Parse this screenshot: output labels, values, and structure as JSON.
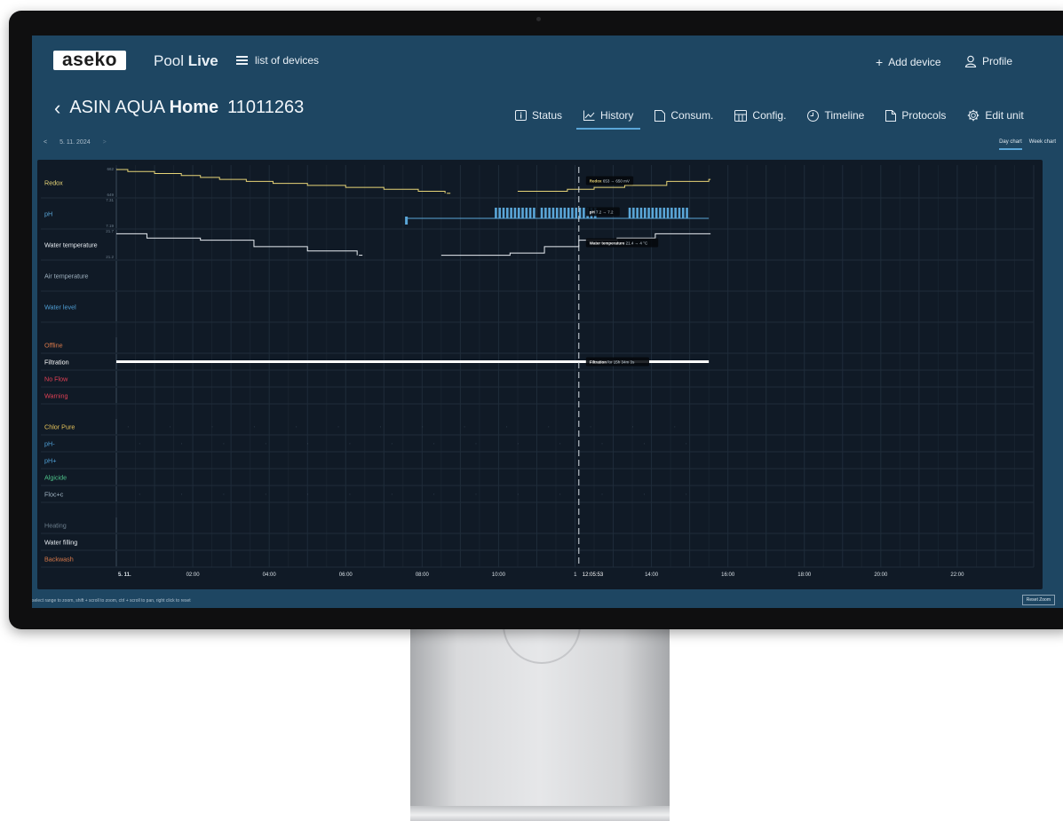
{
  "header": {
    "logo": "aseko",
    "brand_light": "Pool ",
    "brand_bold": "Live",
    "devices_link": "list of devices",
    "add_device": "Add device",
    "profile": "Profile"
  },
  "unit": {
    "name_light": "ASIN AQUA ",
    "name_bold": "Home",
    "serial": "11011263"
  },
  "tabs": [
    {
      "label": "Status",
      "icon": "info-icon"
    },
    {
      "label": "History",
      "icon": "chart-line-icon",
      "active": true
    },
    {
      "label": "Consum.",
      "icon": "document-icon"
    },
    {
      "label": "Config.",
      "icon": "settings-grid-icon"
    },
    {
      "label": "Timeline",
      "icon": "clock-icon"
    },
    {
      "label": "Protocols",
      "icon": "protocol-icon"
    },
    {
      "label": "Edit unit",
      "icon": "gear-icon"
    }
  ],
  "date_nav": {
    "prev": "<",
    "date": "5. 11. 2024",
    "next": ">"
  },
  "chart_switch": {
    "day": "Day chart",
    "week": "Week chart",
    "selected": "day"
  },
  "footer": {
    "hint": "select range to zoom,   shift + scroll to zoom,   ctrl + scroll to pan,   right click to reset",
    "reset_zoom": "Reset Zoom"
  },
  "colors": {
    "redox": "#e6d477",
    "ph": "#5aa6d8",
    "water_temp": "#e8edf2",
    "air_temp": "#9fb2c0",
    "water_level": "#4f9fd6",
    "offline": "#d9794a",
    "filtration": "#ffffff",
    "no_flow": "#e04055",
    "warning": "#e04055",
    "chlor": "#e6c35a",
    "phminus": "#4f9fd6",
    "phplus": "#4f9fd6",
    "algicide": "#4ec28a",
    "floc": "#9fb2c0",
    "heating": "#6c7e8c",
    "water_filling": "#e8edf2",
    "backwash": "#d9794a"
  },
  "chart_data": {
    "type": "line",
    "x_axis": {
      "label": "",
      "range_hours": [
        0,
        24
      ],
      "ticks": [
        "5. 11.",
        "02:00",
        "04:00",
        "06:00",
        "08:00",
        "10:00",
        "12:00",
        "14:00",
        "16:00",
        "18:00",
        "20:00",
        "22:00"
      ]
    },
    "cursor": {
      "time": "12:05:53",
      "hour": 12.1
    },
    "rows": [
      {
        "name": "Redox",
        "color_key": "redox",
        "ymax_label": "662",
        "ymin_label": "649",
        "tooltip_name": "Redox",
        "tooltip_value": "653 → 650 mV",
        "points": [
          [
            0,
            662
          ],
          [
            0.3,
            661
          ],
          [
            1.0,
            660
          ],
          [
            1.7,
            659
          ],
          [
            2.2,
            658
          ],
          [
            2.7,
            657
          ],
          [
            3.4,
            656
          ],
          [
            4.1,
            655
          ],
          [
            5.0,
            654
          ],
          [
            6.0,
            653
          ],
          [
            7.0,
            652
          ],
          [
            7.9,
            651
          ],
          [
            8.6,
            650
          ],
          [
            10.5,
            651
          ],
          [
            11.1,
            651
          ],
          [
            11.8,
            652
          ],
          [
            12.5,
            653
          ],
          [
            13.3,
            654
          ],
          [
            14.4,
            656
          ],
          [
            15.5,
            657
          ]
        ],
        "gap": [
          8.6,
          10.5
        ],
        "ymin": 649,
        "ymax": 662
      },
      {
        "name": "pH",
        "color_key": "ph",
        "ymax_label": "7.31",
        "ymin_label": "7.19",
        "tooltip_name": "pH",
        "tooltip_value": "7.2 → 7.2",
        "baseline_start": 7.6,
        "baseline_end": 15.5,
        "pulse_bands": [
          [
            9.9,
            10.9
          ],
          [
            11.1,
            12.5
          ],
          [
            13.4,
            14.9
          ]
        ]
      },
      {
        "name": "Water temperature",
        "color_key": "water_temp",
        "ymax_label": "21.7",
        "ymin_label": "21.2",
        "tooltip_name": "Water temperature",
        "tooltip_value": "21.4 → 4 °C",
        "points": [
          [
            0,
            21.7
          ],
          [
            0.8,
            21.6
          ],
          [
            2.2,
            21.55
          ],
          [
            3.6,
            21.4
          ],
          [
            5.0,
            21.3
          ],
          [
            6.3,
            21.2
          ],
          [
            8.5,
            21.2
          ],
          [
            9.2,
            21.2
          ],
          [
            10.3,
            21.25
          ],
          [
            11.2,
            21.4
          ],
          [
            12.1,
            21.55
          ],
          [
            13.1,
            21.6
          ],
          [
            14.1,
            21.7
          ],
          [
            15.5,
            21.7
          ]
        ],
        "gap": [
          6.3,
          8.1
        ],
        "ymin": 21.15,
        "ymax": 21.75
      },
      {
        "name": "Air temperature",
        "color_key": "air_temp"
      },
      {
        "name": "Water level",
        "color_key": "water_level"
      },
      {
        "name": "Offline",
        "color_key": "offline"
      },
      {
        "name": "Filtration",
        "color_key": "filtration",
        "on_from": 0,
        "on_to": 15.5,
        "tooltip_name": "Filtration",
        "tooltip_value": "for 15h 34m 3s"
      },
      {
        "name": "No Flow",
        "color_key": "no_flow"
      },
      {
        "name": "Warning",
        "color_key": "warning"
      },
      {
        "name": "Chlor Pure",
        "color_key": "chlor"
      },
      {
        "name": "pH-",
        "color_key": "phminus"
      },
      {
        "name": "pH+",
        "color_key": "phplus"
      },
      {
        "name": "Algicide",
        "color_key": "algicide"
      },
      {
        "name": "Floc+c",
        "color_key": "floc"
      },
      {
        "name": "Heating",
        "color_key": "heating"
      },
      {
        "name": "Water filling",
        "color_key": "water_filling"
      },
      {
        "name": "Backwash",
        "color_key": "backwash"
      }
    ]
  }
}
